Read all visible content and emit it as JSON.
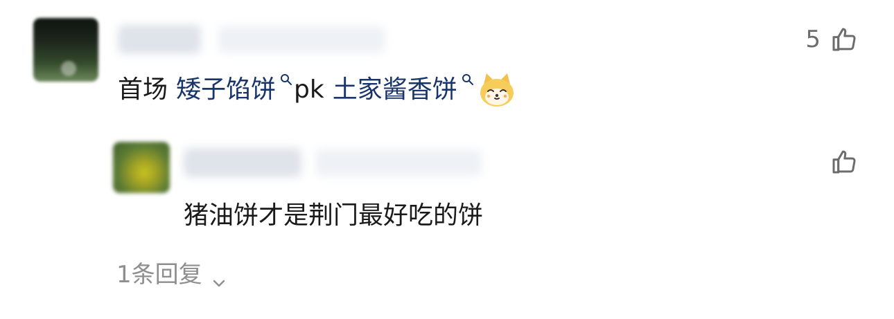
{
  "comment": {
    "text_prefix": "首场",
    "topic_1": "矮子馅饼",
    "middle_text": "pk",
    "topic_2": "土家酱香饼",
    "emoji": "doge-cat-emoji",
    "like_count": "5"
  },
  "reply": {
    "text": "猪油饼才是荆门最好吃的饼"
  },
  "footer": {
    "more_replies": "1条回复"
  },
  "colors": {
    "topic_link": "#18356b",
    "text": "#1a1a1a",
    "muted": "#8e8e8e",
    "icon": "#6c6c6c"
  }
}
